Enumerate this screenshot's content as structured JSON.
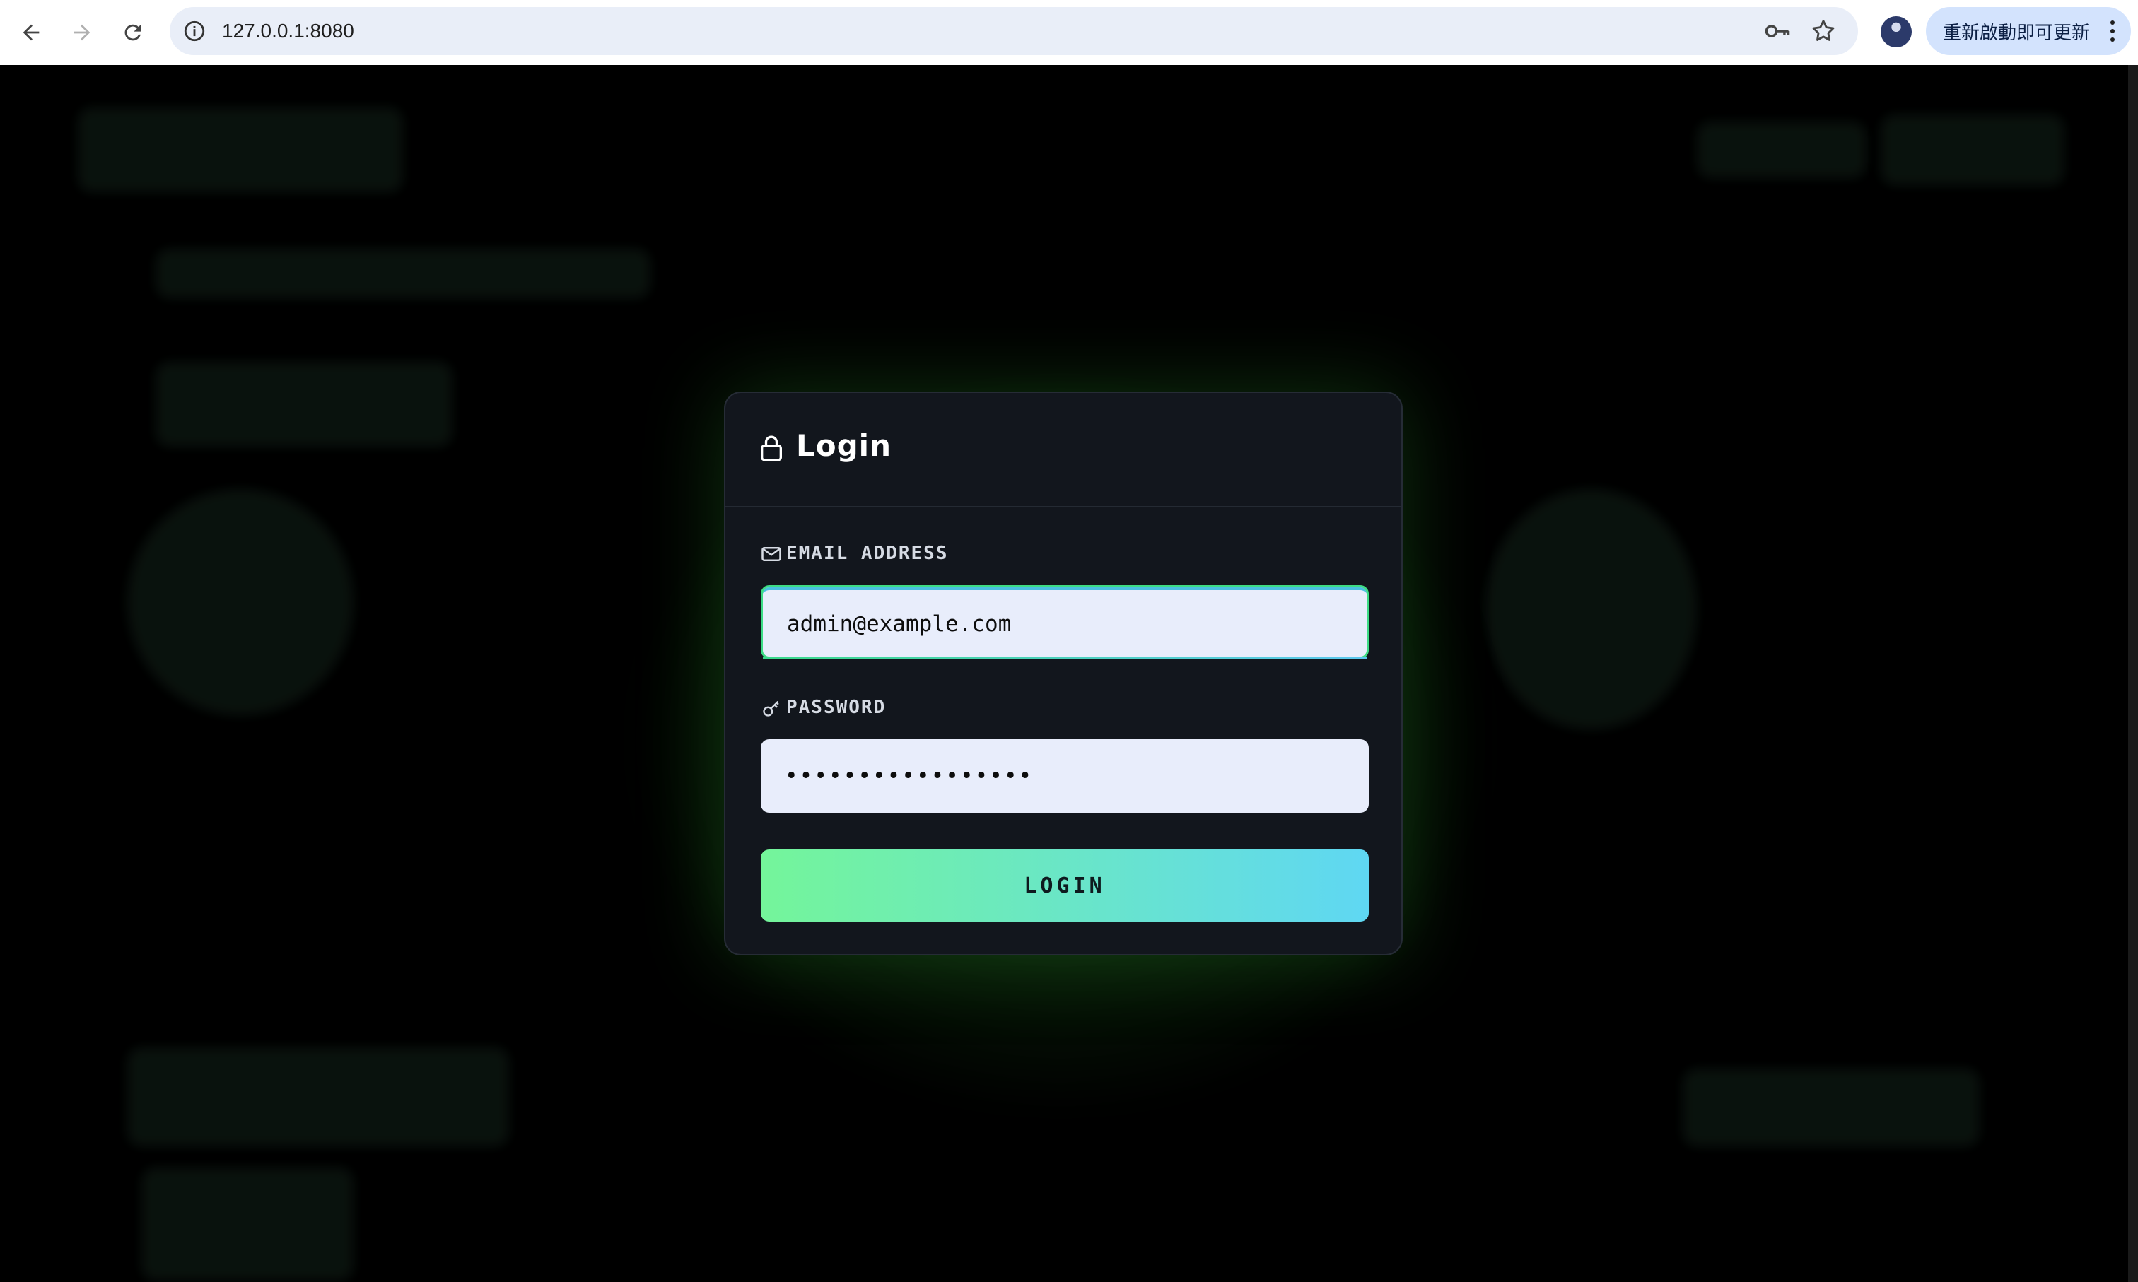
{
  "browser": {
    "url": "127.0.0.1:8080",
    "update_label": "重新啟動即可更新"
  },
  "login": {
    "title": "Login",
    "email_label": "EMAIL ADDRESS",
    "email_value": "admin@example.com",
    "password_label": "PASSWORD",
    "password_value": "•••••••••••••••••",
    "button_label": "LOGIN"
  },
  "colors": {
    "accent_green": "#74f59a",
    "accent_cyan": "#5fd7f3",
    "card_bg": "#12161d",
    "input_bg": "#e8edfb"
  },
  "icons": {
    "back": "arrow-left-icon",
    "forward": "arrow-right-icon",
    "reload": "reload-icon",
    "site_info": "info-icon",
    "passwords": "key-icon",
    "bookmark": "star-icon",
    "menu": "more-vert-icon",
    "title": "lock-icon",
    "email": "envelope-icon",
    "password": "key-icon"
  }
}
